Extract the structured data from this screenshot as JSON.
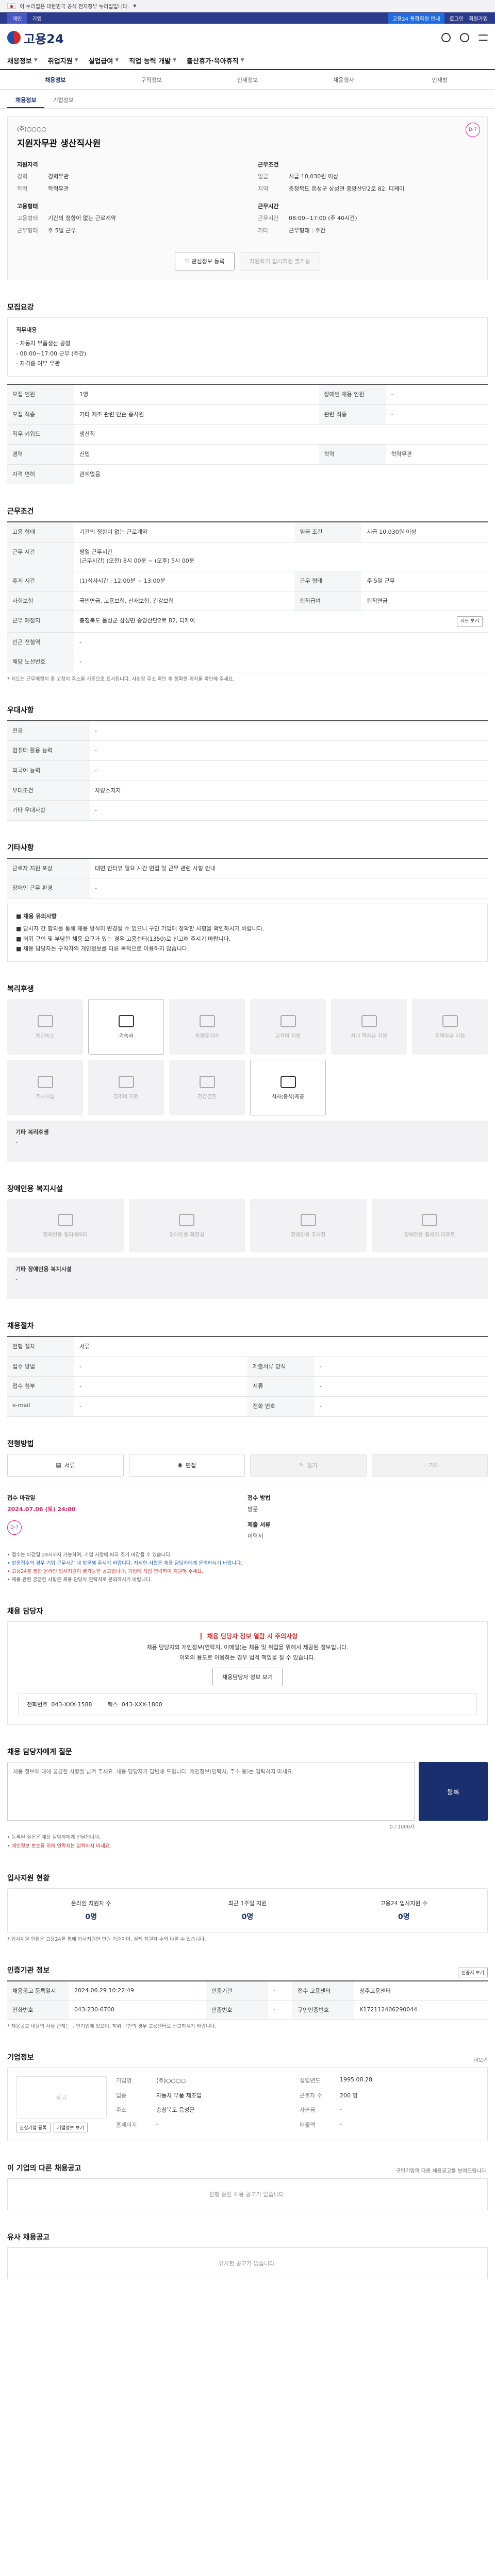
{
  "gov_banner": {
    "text": "이 누리집은 대한민국 공식 전자정부 누리집입니다.",
    "flag": "taegukgi-flag"
  },
  "topbar": {
    "tabs": [
      "개인",
      "기업"
    ],
    "links": [
      "로그인",
      "회원가입"
    ],
    "highlight": "고용24 통합회원 안내"
  },
  "header": {
    "logo_text": "고용24",
    "icons": [
      "search-icon",
      "user-icon",
      "menu-icon"
    ]
  },
  "gnb": [
    "채용정보",
    "취업지원",
    "실업급여",
    "직업 능력 개발",
    "출산휴가·육아휴직"
  ],
  "subnav": {
    "items": [
      "채용정보",
      "구직정보",
      "인재정보",
      "채용행사",
      "인재방"
    ],
    "active": 0
  },
  "tabs": {
    "items": [
      "채용정보",
      "기업정보"
    ],
    "active": 0
  },
  "job": {
    "company": "(주)○○○○",
    "title": "지원자무관 생산직사원",
    "dday": "D-7",
    "qualifications_title": "지원자격",
    "work_title": "근무조건",
    "career_label": "경력",
    "career": "경력무관",
    "education_label": "학력",
    "education": "학력무관",
    "wage_label": "임금",
    "wage": "시급 10,030원 이상",
    "location_label": "지역",
    "location": "충청북도 음성군 삼성면 중앙산단2로 82, 디케이",
    "emp_label": "고용형태",
    "emp_title": "고용형태",
    "emp_type": "기간의 정함이 없는 근로계약",
    "emp_type2_label": "근무형태",
    "emp_type2": "주 5일 근무",
    "hours_label": "근무시간",
    "hours_title": "근무시간",
    "hours": "08:00~17:00 (주 40시간)",
    "hours2_label": "기타",
    "hours2": "근무형태 : 주간",
    "save_button": "관심정보 등록",
    "apply_button": "지원하기 입사지원 불가능"
  },
  "recruit": {
    "section_title": "모집요강",
    "box_title": "직무내용",
    "box_lines": [
      "- 자동차 부품생산 공정",
      "- 08:00~17:00 근무 (주간)",
      "- 자격증 여부 무관"
    ],
    "rows": [
      {
        "k1": "모집 인원",
        "v1": "1명",
        "k2": "장애인 채용 인원",
        "v2": "-"
      },
      {
        "k1": "모집 직종",
        "v1": "기타 제조 관련 단순 종사원",
        "k2": "관련 직종",
        "v2": "-"
      },
      {
        "k1": "직무 키워드",
        "v1": "생산직"
      },
      {
        "k1": "경력",
        "v1": "신입",
        "k2": "학력",
        "v2": "학력무관"
      },
      {
        "k1": "자격 면허",
        "v1": "관계없음"
      }
    ]
  },
  "conditions": {
    "section_title": "근무조건",
    "rows": [
      {
        "k1": "고용 형태",
        "v1": "기간의 정함이 없는 근로계약",
        "k2": "임금 조건",
        "v2": "시급 10,030원 이상"
      },
      {
        "k1": "근무 시간",
        "v1": "평일 근무시간\n(근무시간) (오전) 8시 00분 ~ (오후) 5시 00분"
      },
      {
        "k1": "휴게 시간",
        "v1": "(1)식사시간 : 12:00분 ~ 13:00분",
        "k2": "근무 형태",
        "v2": "주 5일 근무"
      },
      {
        "k1": "사회보험",
        "v1": "국민연금, 고용보험, 산재보험, 건강보험",
        "k2": "퇴직급여",
        "v2": "퇴직연금"
      },
      {
        "k1": "근무 예정지",
        "v1": "충청북도 음성군 삼성면 중앙산단2로 82, 디케이",
        "map_btn": "지도 보기"
      },
      {
        "k1": "인근 전철역",
        "v1": "-"
      },
      {
        "k1": "해당 노선번호",
        "v1": "-"
      }
    ],
    "note": "* 지도는 근무예정지 중 고정지 주소를 기준으로 표시됩니다. 사업장 주소 확인 후 정확한 위치를 확인해 주세요."
  },
  "benefits": {
    "section_title": "우대사항",
    "rows": [
      {
        "k": "전공",
        "v": "-"
      },
      {
        "k": "컴퓨터 활용 능력",
        "v": "-"
      },
      {
        "k": "외국어 능력",
        "v": "-"
      },
      {
        "k": "우대조건",
        "v": "차량소지자"
      },
      {
        "k": "기타 우대사항",
        "v": "-"
      }
    ]
  },
  "extra": {
    "section_title": "기타사항",
    "rows": [
      {
        "k": "근로자 지원 포상",
        "v": "대면 인터뷰 필요 시간 면접 및 근무 관련 사항 안내"
      },
      {
        "k": "장애인 근무 환경",
        "v": "-"
      }
    ],
    "warn_title": "■ 채용 유의사항",
    "warn_lines": [
      "■ 당사자 간 합의를 통해 채용 방식이 변경될 수 있으니 구인 기업에 정확한 사항을 확인하시기 바랍니다.",
      "■ 허위 구인 및 부당한 채용 요구가 있는 경우 고용센터(1350)로 신고해 주시기 바랍니다.",
      "■ 채용 담당자는 구직자의 개인정보를 다른 목적으로 이용하지 않습니다."
    ]
  },
  "welfare": {
    "section_title": "복리후생",
    "items": [
      {
        "label": "통근버스",
        "icon": "bus-icon",
        "on": false
      },
      {
        "label": "기숙사",
        "icon": "dorm-icon",
        "on": true
      },
      {
        "label": "차량유지비",
        "icon": "car-icon",
        "on": false
      },
      {
        "label": "교육비 지원",
        "icon": "education-icon",
        "on": false
      },
      {
        "label": "자녀 학자금 지원",
        "icon": "scholarship-icon",
        "on": false
      },
      {
        "label": "주택자금 지원",
        "icon": "house-icon",
        "on": false
      },
      {
        "label": "주차시설",
        "icon": "parking-icon",
        "on": false
      },
      {
        "label": "경조비 지원",
        "icon": "gift-icon",
        "on": false
      },
      {
        "label": "건강검진",
        "icon": "health-icon",
        "on": false
      },
      {
        "label": "식사(중식)제공",
        "icon": "meal-icon",
        "on": true
      }
    ],
    "other_label": "기타 복리후생",
    "other_value": "-"
  },
  "disabled": {
    "section_title": "장애인용 복지시설",
    "items": [
      {
        "label": "장애인용 엘리베이터",
        "icon": "elevator-icon"
      },
      {
        "label": "장애인용 화장실",
        "icon": "toilet-icon"
      },
      {
        "label": "장애인용 주차장",
        "icon": "parking-icon"
      },
      {
        "label": "장애인용 휠체어 리프트",
        "icon": "wheelchair-icon"
      }
    ],
    "other_label": "기타 장애인용 복지시설",
    "other_value": "-"
  },
  "process": {
    "section_title": "채용절차",
    "rows": [
      {
        "k1": "전형 절차",
        "v1": "서류"
      },
      {
        "k1": "접수 방법",
        "v1": "-",
        "k2": "제출서류 양식",
        "v2": "-"
      },
      {
        "k1": "접수 첨부",
        "v1": "-",
        "k2": "서류",
        "v2": "-"
      },
      {
        "k1": "e-mail",
        "v1": "-",
        "k2": "전화 번호",
        "v2": "-"
      }
    ]
  },
  "apply": {
    "section_title": "전형방법",
    "buttons": [
      {
        "label": "서류",
        "on": true
      },
      {
        "label": "면접",
        "on": true
      },
      {
        "label": "필기",
        "on": false
      },
      {
        "label": "기타",
        "on": false
      }
    ],
    "deadline_label": "접수 마감일",
    "deadline": "2024.07.06 (토) 24:00",
    "dday": "D-7",
    "method_label": "접수 방법",
    "method": "방문",
    "sample_label": "제출 서류",
    "sample": "이력서",
    "ref_lines": [
      "• 접수는 마감일 24시까지 가능하며, 기업 사정에 따라 조기 마감될 수 있습니다.",
      "• 방문접수의 경우 기업 근무시간 내 방문해 주시기 바랍니다. 자세한 사항은 채용 담당자에게 문의하시기 바랍니다.",
      "• 고용24를 통한 온라인 입사지원이 불가능한 공고입니다. 기업에 직접 연락하여 지원해 주세요.",
      "• 채용 관련 궁금한 사항은 채용 담당자 연락처로 문의하시기 바랍니다."
    ]
  },
  "contact": {
    "section_title": "채용 담당자",
    "alert_title": "채용 담당자 정보 열람 시 주의사항",
    "alert_lines": [
      "채용 담당자의 개인정보(연락처, 이메일)는 채용 및 취업을 위해서 제공된 정보입니다.",
      "이외의 용도로 이용하는 경우 법적 책임을 질 수 있습니다."
    ],
    "view_btn": "채용담당자 정보 보기",
    "phone_label": "전화번호",
    "phone": "043-XXX-1588",
    "fax_label": "팩스",
    "fax": "043-XXX-1800"
  },
  "question": {
    "section_title": "채용 담당자에게 질문",
    "placeholder": "채용 정보에 대해 궁금한 사항을 남겨 주세요. 채용 담당자가 답변해 드립니다. 개인정보(연락처, 주소 등)는 입력하지 마세요.",
    "counter": "0 / 1000자",
    "submit": "등록",
    "notes": [
      "• 등록된 질문은 채용 담당자에게 전달됩니다.",
      "• 개인정보 보호를 위해 연락처는 입력하지 마세요."
    ]
  },
  "status": {
    "section_title": "입사지원 현황",
    "items": [
      {
        "label": "온라인 지원자 수",
        "value": "0명"
      },
      {
        "label": "최근 1주일 지원",
        "value": "0명"
      },
      {
        "label": "고용24 입사지원 수",
        "value": "0명"
      }
    ],
    "note": "* 입사지원 현황은 고용24를 통해 입사지원한 인원 기준이며, 실제 지원자 수와 다를 수 있습니다."
  },
  "auth": {
    "section_title": "인증기관 정보",
    "btn": "인증서 보기",
    "rows": [
      {
        "k1": "채용공고 등록일시",
        "v1": "2024.06.29 10:22:49",
        "k2": "인증기관",
        "v2": "-",
        "k3": "접수 고용센터",
        "v3": "청주고용센터"
      },
      {
        "k1": "전화번호",
        "v1": "043-230-6700",
        "k2": "인증번호",
        "v2": "-",
        "k3": "구인인증번호",
        "v3": "K172112406290044"
      }
    ],
    "note": "* 채용공고 내용의 사실 관계는 구인기업에 있으며, 허위 구인의 경우 고용센터로 신고하시기 바랍니다."
  },
  "company": {
    "section_title": "기업정보",
    "more": "더보기",
    "logo_placeholder": "로고",
    "rows": [
      [
        "기업명",
        "(주)○○○○",
        "설립년도",
        "1995.08.28"
      ],
      [
        "업종",
        "자동차 부품 제조업",
        "근로자 수",
        "200 명"
      ],
      [
        "주소",
        "충청북도 음성군",
        "자본금",
        "-"
      ],
      [
        "홈페이지",
        "-",
        "매출액",
        "-"
      ]
    ],
    "btns": [
      "관심기업 등록",
      "기업정보 보기"
    ]
  },
  "related": {
    "section_title": "이 기업의 다른 채용공고",
    "sub": "구인기업의 다른 채용공고를 보여드립니다.",
    "empty": "진행 중인 채용 공고가 없습니다."
  },
  "similar": {
    "section_title": "유사 채용공고",
    "empty": "유사한 공고가 없습니다."
  }
}
